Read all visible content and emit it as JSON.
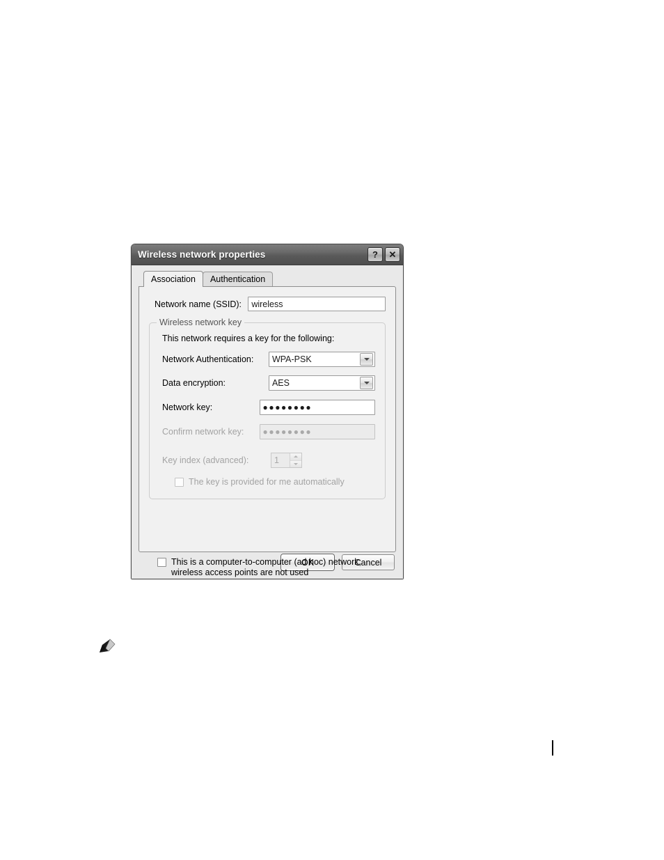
{
  "dialog": {
    "title": "Wireless network properties",
    "titlebar_buttons": [
      {
        "name": "help-button",
        "glyph": "?"
      },
      {
        "name": "close-button",
        "glyph": "✕"
      }
    ],
    "tabs": [
      {
        "label": "Association",
        "active": true
      },
      {
        "label": "Authentication",
        "active": false
      }
    ],
    "association": {
      "ssid_label": "Network name (SSID):",
      "ssid_value": "wireless",
      "group": {
        "legend": "Wireless network key",
        "description": "This network requires a key for the following:",
        "network_authentication_label": "Network Authentication:",
        "network_authentication_value": "WPA-PSK",
        "data_encryption_label": "Data encryption:",
        "data_encryption_value": "AES",
        "network_key_label": "Network key:",
        "network_key_value": "●●●●●●●●",
        "confirm_network_key_label": "Confirm network key:",
        "confirm_network_key_value": "●●●●●●●●",
        "key_index_label": "Key index (advanced):",
        "key_index_value": "1",
        "auto_key_label": "The key is provided for me automatically"
      },
      "adhoc_label": "This is a computer-to-computer (ad hoc) network; wireless access points are not used"
    },
    "buttons": {
      "ok": "OK",
      "cancel": "Cancel"
    }
  },
  "colors": {
    "titlebar_dark": "#5a5a5a",
    "dialog_face": "#e9e9e9",
    "tabpage_face": "#f1f1f1",
    "disabled_text": "#a3a3a3"
  }
}
